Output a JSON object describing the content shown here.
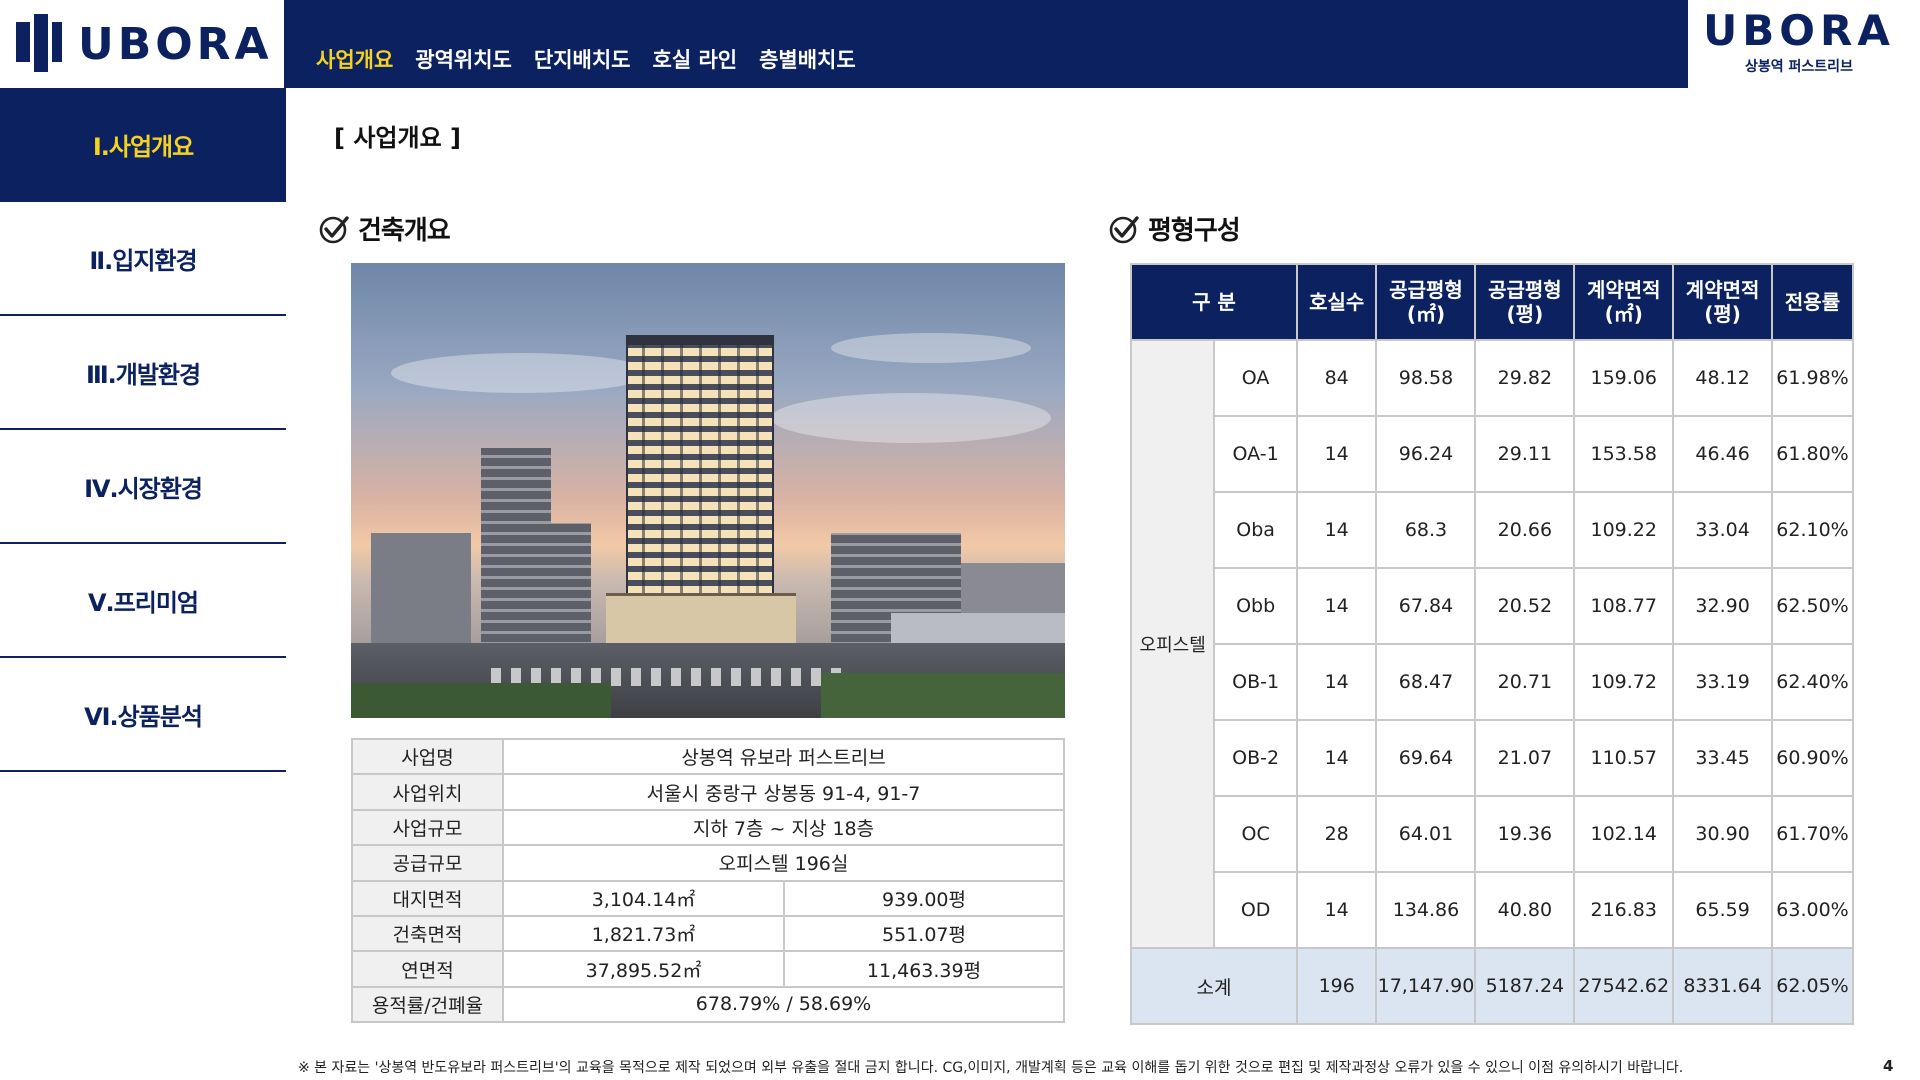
{
  "header": {
    "logo_text": "UBORA",
    "nav": [
      "사업개요",
      "광역위치도",
      "단지배치도",
      "호실 라인",
      "층별배치도"
    ],
    "brand_big": "UBORA",
    "brand_small": "상봉역 퍼스트리브"
  },
  "sidebar": {
    "items": [
      "Ⅰ.사업개요",
      "Ⅱ.입지환경",
      "Ⅲ.개발환경",
      "Ⅳ.시장환경",
      "Ⅴ.프리미엄",
      "Ⅵ.상품분석"
    ]
  },
  "main": {
    "section_title": "[ 사업개요 ]",
    "left_head": "건축개요",
    "right_head": "평형구성",
    "info_rows": [
      {
        "label": "사업명",
        "value": "상봉역 유보라 퍼스트리브"
      },
      {
        "label": "사업위치",
        "value": "서울시 중랑구 상봉동 91-4, 91-7"
      },
      {
        "label": "사업규모",
        "value": "지하 7층 ~ 지상 18층"
      },
      {
        "label": "공급규모",
        "value": "오피스텔 196실"
      },
      {
        "label": "대지면적",
        "v1": "3,104.14㎡",
        "v2": "939.00평"
      },
      {
        "label": "건축면적",
        "v1": "1,821.73㎡",
        "v2": "551.07평"
      },
      {
        "label": "연면적",
        "v1": "37,895.52㎡",
        "v2": "11,463.39평"
      },
      {
        "label": "용적률/건폐율",
        "value": "678.79% / 58.69%"
      }
    ],
    "type_table": {
      "headers": [
        "구 분",
        "호실수",
        "공급평형\n(㎡)",
        "공급평형\n(평)",
        "계약면적\n(㎡)",
        "계약면적\n(평)",
        "전용률"
      ],
      "group": "오피스텔",
      "rows": [
        [
          "OA",
          "84",
          "98.58",
          "29.82",
          "159.06",
          "48.12",
          "61.98%"
        ],
        [
          "OA-1",
          "14",
          "96.24",
          "29.11",
          "153.58",
          "46.46",
          "61.80%"
        ],
        [
          "Oba",
          "14",
          "68.3",
          "20.66",
          "109.22",
          "33.04",
          "62.10%"
        ],
        [
          "Obb",
          "14",
          "67.84",
          "20.52",
          "108.77",
          "32.90",
          "62.50%"
        ],
        [
          "OB-1",
          "14",
          "68.47",
          "20.71",
          "109.72",
          "33.19",
          "62.40%"
        ],
        [
          "OB-2",
          "14",
          "69.64",
          "21.07",
          "110.57",
          "33.45",
          "60.90%"
        ],
        [
          "OC",
          "28",
          "64.01",
          "19.36",
          "102.14",
          "30.90",
          "61.70%"
        ],
        [
          "OD",
          "14",
          "134.86",
          "40.80",
          "216.83",
          "65.59",
          "63.00%"
        ]
      ],
      "total": [
        "소계",
        "196",
        "17,147.90",
        "5187.24",
        "27542.62",
        "8331.64",
        "62.05%"
      ]
    }
  },
  "footer": {
    "note": "※ 본 자료는 '상봉역 반도유보라 퍼스트리브'의 교육을 목적으로 제작 되었으며 외부 유출을 절대 금지 합니다. CG,이미지, 개발계획 등은 교육 이해를 돕기 위한 것으로 편집 및 제작과정상 오류가 있을 수 있으니 이점 유의하시기 바랍니다.",
    "page": "4"
  },
  "colors": {
    "navy": "#0b2160",
    "accent": "#f4d21f",
    "sum_row": "#dbe5f1"
  }
}
